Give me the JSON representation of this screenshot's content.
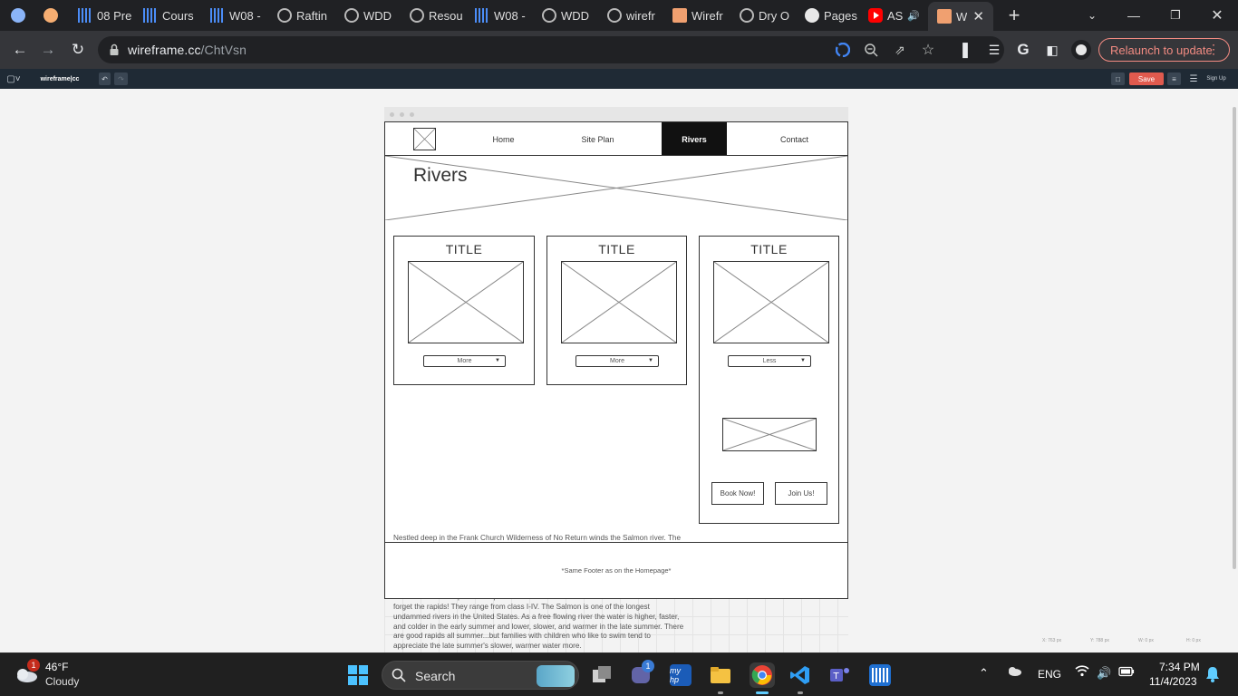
{
  "browser": {
    "tabs": [
      {
        "label": "",
        "icon": "blue-circle-icon",
        "active": false
      },
      {
        "label": "",
        "icon": "orange-circle-icon",
        "active": false
      },
      {
        "label": "08 Pre",
        "icon": "canvas-bars-icon",
        "active": false
      },
      {
        "label": "Cours",
        "icon": "canvas-bars-icon",
        "active": false
      },
      {
        "label": "W08 -",
        "icon": "canvas-bars-icon",
        "active": false
      },
      {
        "label": "Raftin",
        "icon": "globe-icon",
        "active": false
      },
      {
        "label": "WDD",
        "icon": "globe-icon",
        "active": false
      },
      {
        "label": "Resou",
        "icon": "globe-icon",
        "active": false
      },
      {
        "label": "W08 -",
        "icon": "canvas-bars-icon",
        "active": false
      },
      {
        "label": "WDD",
        "icon": "globe-icon",
        "active": false
      },
      {
        "label": "wirefr",
        "icon": "globe-icon",
        "active": false
      },
      {
        "label": "Wirefr",
        "icon": "wireframe-icon",
        "active": false
      },
      {
        "label": "Dry O",
        "icon": "globe-icon",
        "active": false
      },
      {
        "label": "Pages",
        "icon": "github-icon",
        "active": false
      },
      {
        "label": "AS",
        "icon": "youtube-icon",
        "active": false
      },
      {
        "label": "W",
        "icon": "wireframe-icon",
        "active": true
      }
    ],
    "url_host": "wireframe.cc",
    "url_path": "/ChtVsn",
    "relaunch_label": "Relaunch to update"
  },
  "appbar": {
    "logo": "wireframe|cc",
    "save_label": "Save",
    "signup_label": "Sign Up"
  },
  "wireframe": {
    "nav": [
      "Home",
      "Site Plan",
      "Rivers",
      "Contact"
    ],
    "active_nav": "Rivers",
    "hero_title": "Rivers",
    "cards": [
      {
        "title": "TITLE",
        "dropdown": "More"
      },
      {
        "title": "TITLE",
        "dropdown": "More"
      },
      {
        "title": "TITLE",
        "dropdown": "Less"
      }
    ],
    "body_text": "Nestled deep in the Frank Church Wilderness of No Return winds the Salmon river. The Salmon was given the nickname long ago as the River of No Return by the people living near it because of the number of folks that came to visit and fell so in love with the rugged beauty of the river that they never left.Herds of elk and deer graze on the hillsides around the river and bear and bighorn sheep are also commonly sighted. The river corridor is also lined with awe inspiring ponderosa pine which tower over the sandy beaches in the campsites and provide shelter from sun or rain when needed.Let's not forget the rapids! They range from class I-IV. The Salmon is one of the longest undammed rivers in the United States. As a free flowing river the water is higher, faster, and colder in the early summer and lower, slower, and warmer in the late summer. There are good rapids all summer...but families with children who like to swim tend to appreciate the late summer's slower, warmer water more.",
    "buttons": [
      "Book Now!",
      "Join Us!"
    ],
    "footer": "*Same Footer as on the Homepage*"
  },
  "status_coords": [
    "X: 763 px",
    "Y: 788 px",
    "W: 0 px",
    "H: 0 px"
  ],
  "taskbar": {
    "weather_temp": "46°F",
    "weather_cond": "Cloudy",
    "weather_badge": "1",
    "search_label": "Search",
    "teams_badge": "1",
    "language": "ENG",
    "time": "7:34 PM",
    "date": "11/4/2023"
  },
  "colors": {
    "accent_red": "#e05a4e",
    "relaunch": "#f28b82",
    "chrome_dark": "#202124"
  }
}
